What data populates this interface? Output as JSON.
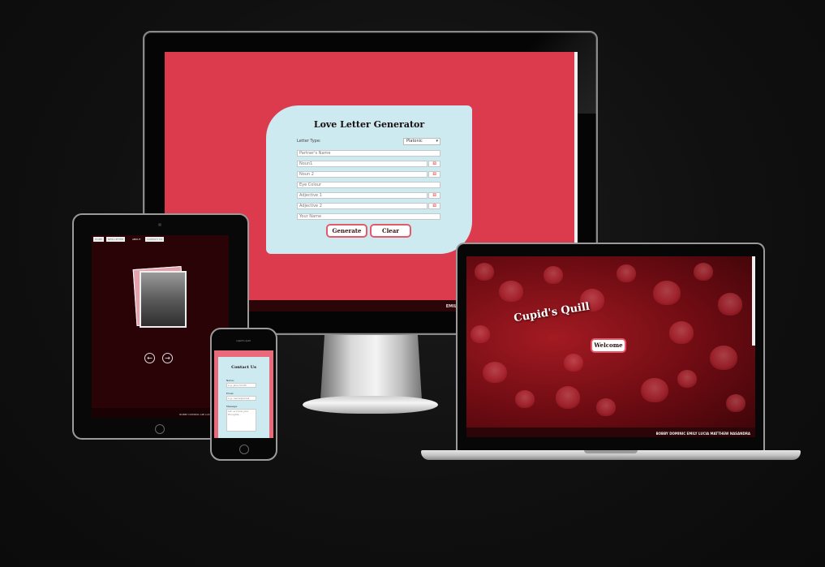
{
  "desktop": {
    "card_title": "Love Letter Generator",
    "letter_type_label": "Letter Type:",
    "letter_type_value": "Platonic",
    "fields": {
      "partner_name": "Partner's Name",
      "noun1": "Noun1",
      "noun2": "Noun 2",
      "eye_colour": "Eye Colour",
      "adjective1": "Adjective 1",
      "adjective2": "Adjective 2",
      "your_name": "Your Name"
    },
    "generate_label": "Generate",
    "clear_label": "Clear",
    "footer_text": "EMILY"
  },
  "tablet": {
    "nav": [
      "HOME",
      "NEW LETTER",
      "ABOUT",
      "CONTACT US"
    ],
    "footer_text": "BOBBY  DOMINIC  AMI  LUCIA  MATTHEW"
  },
  "phone": {
    "header": "cupid's quill",
    "title": "Contact Us",
    "name_label": "Name:",
    "name_placeholder": "e.g. Jane Smith",
    "email_label": "Email:",
    "email_placeholder": "e.g. name@email",
    "message_label": "Message:",
    "message_placeholder": "Let us know your thoughts..."
  },
  "laptop": {
    "title": "Cupid's Quill",
    "welcome_label": "Welcome",
    "footer_text": "BOBBY  DOMINIC  EMILY  LUCIA  MATTHEW  NASANDRA"
  },
  "colors": {
    "desktop_bg": "#dc3a4d",
    "card_bg": "#cdeaf1",
    "button_border": "#e55a6b",
    "footer_bg": "#2b0508"
  }
}
